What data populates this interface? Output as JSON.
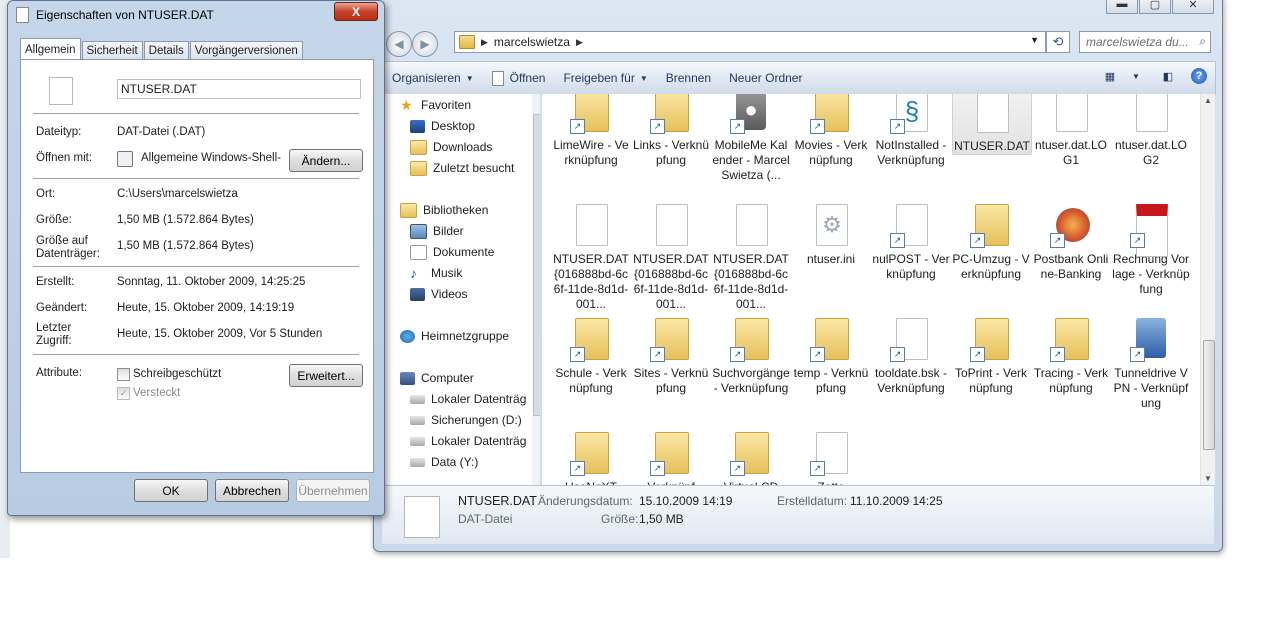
{
  "explorer": {
    "breadcrumb": [
      "marcelswietza"
    ],
    "search_placeholder": "marcelswietza du...",
    "toolbar": {
      "organize": "Organisieren",
      "open": "Öffnen",
      "share": "Freigeben für",
      "burn": "Brennen",
      "new_folder": "Neuer Ordner"
    },
    "nav": {
      "favorites": "Favoriten",
      "desktop": "Desktop",
      "downloads": "Downloads",
      "recent": "Zuletzt besucht",
      "libraries": "Bibliotheken",
      "pictures": "Bilder",
      "documents": "Dokumente",
      "music": "Musik",
      "videos": "Videos",
      "homegroup": "Heimnetzgruppe",
      "computer": "Computer",
      "local1": "Lokaler Datenträg",
      "backups": "Sicherungen (D:)",
      "local2": "Lokaler Datenträg",
      "data": "Data (Y:)"
    },
    "items": [
      {
        "label": "LimeWire - Verknüpfung",
        "kind": "folder",
        "shortcut": true
      },
      {
        "label": "Links - Verknüpfung",
        "kind": "folder",
        "shortcut": true
      },
      {
        "label": "MobileMe Kalender - Marcel Swietza (...",
        "kind": "app",
        "shortcut": true
      },
      {
        "label": "Movies - Verknüpfung",
        "kind": "folder",
        "shortcut": true
      },
      {
        "label": "NotInstalled - Verknüpfung",
        "kind": "script",
        "shortcut": true
      },
      {
        "label": "NTUSER.DAT",
        "kind": "file",
        "shortcut": false
      },
      {
        "label": "ntuser.dat.LOG1",
        "kind": "file",
        "shortcut": false
      },
      {
        "label": "ntuser.dat.LOG2",
        "kind": "file",
        "shortcut": false
      },
      {
        "label": "NTUSER.DAT{016888bd-6c6f-11de-8d1d-001...",
        "kind": "file",
        "shortcut": false
      },
      {
        "label": "NTUSER.DAT{016888bd-6c6f-11de-8d1d-001...",
        "kind": "file",
        "shortcut": false
      },
      {
        "label": "NTUSER.DAT{016888bd-6c6f-11de-8d1d-001...",
        "kind": "file",
        "shortcut": false
      },
      {
        "label": "ntuser.ini",
        "kind": "settings",
        "shortcut": false
      },
      {
        "label": "nulPOST - Verknüpfung",
        "kind": "file",
        "shortcut": true
      },
      {
        "label": "PC-Umzug - Verknüpfung",
        "kind": "folder",
        "shortcut": true
      },
      {
        "label": "Postbank Online-Banking",
        "kind": "firefox",
        "shortcut": true
      },
      {
        "label": "Rechnung Vorlage - Verknüpfung",
        "kind": "pdf",
        "shortcut": true
      },
      {
        "label": "Schule - Verknüpfung",
        "kind": "folder",
        "shortcut": true
      },
      {
        "label": "Sites - Verknüpfung",
        "kind": "folder",
        "shortcut": true
      },
      {
        "label": "Suchvorgänge - Verknüpfung",
        "kind": "folder",
        "shortcut": true
      },
      {
        "label": "temp - Verknüpfung",
        "kind": "folder",
        "shortcut": true
      },
      {
        "label": "tooldate.bsk - Verknüpfung",
        "kind": "file",
        "shortcut": true
      },
      {
        "label": "ToPrint - Verknüpfung",
        "kind": "folder",
        "shortcut": true
      },
      {
        "label": "Tracing - Verknüpfung",
        "kind": "folder",
        "shortcut": true
      },
      {
        "label": "Tunneldrive VPN - Verknüpfung",
        "kind": "network",
        "shortcut": true
      },
      {
        "label": "UseNeXT",
        "kind": "folder",
        "shortcut": true
      },
      {
        "label": "Verknüpf",
        "kind": "folder",
        "shortcut": true
      },
      {
        "label": "Virtual CD",
        "kind": "folder",
        "shortcut": true
      },
      {
        "label": "Zotte",
        "kind": "file",
        "shortcut": true
      }
    ],
    "details": {
      "name": "NTUSER.DAT",
      "type": "DAT-Datei",
      "modified_label": "Änderungsdatum:",
      "modified_value": "15.10.2009 14:19",
      "size_label": "Größe:",
      "size_value": "1,50 MB",
      "created_label": "Erstelldatum:",
      "created_value": "11.10.2009 14:25"
    }
  },
  "props": {
    "title": "Eigenschaften von NTUSER.DAT",
    "close": "X",
    "tabs": [
      "Allgemein",
      "Sicherheit",
      "Details",
      "Vorgängerversionen"
    ],
    "filename": "NTUSER.DAT",
    "rows": {
      "type_label": "Dateityp:",
      "type_value": "DAT-Datei (.DAT)",
      "open_label": "Öffnen mit:",
      "open_value": "Allgemeine Windows-Shell-DL",
      "change_btn": "Ändern...",
      "location_label": "Ort:",
      "location_value": "C:\\Users\\marcelswietza",
      "size_label": "Größe:",
      "size_value": "1,50 MB (1.572.864 Bytes)",
      "disk_label_1": "Größe auf",
      "disk_label_2": "Datenträger:",
      "disk_value": "1,50 MB (1.572.864 Bytes)",
      "created_label": "Erstellt:",
      "created_value": "Sonntag, 11. Oktober 2009, 14:25:25",
      "modified_label": "Geändert:",
      "modified_value": "Heute, 15. Oktober 2009, 14:19:19",
      "access_label_1": "Letzter",
      "access_label_2": "Zugriff:",
      "access_value": "Heute, 15. Oktober 2009, Vor 5 Stunden",
      "attr_label": "Attribute:",
      "readonly": "Schreibgeschützt",
      "hidden": "Versteckt",
      "advanced_btn": "Erweitert..."
    },
    "buttons": {
      "ok": "OK",
      "cancel": "Abbrechen",
      "apply": "Übernehmen"
    }
  }
}
